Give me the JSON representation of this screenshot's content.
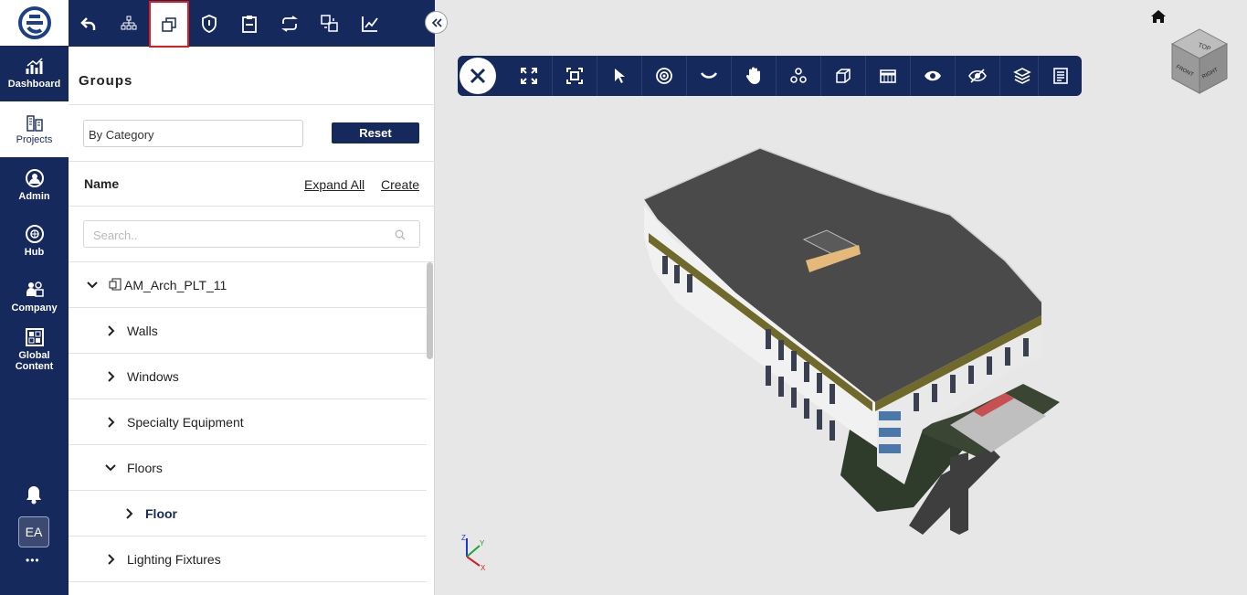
{
  "nav": {
    "items": [
      {
        "label": "Dashboard",
        "icon": "dashboard-chart-icon"
      },
      {
        "label": "Projects",
        "icon": "buildings-icon"
      },
      {
        "label": "Admin",
        "icon": "admin-user-icon"
      },
      {
        "label": "Hub",
        "icon": "hub-globe-icon"
      },
      {
        "label": "Company",
        "icon": "company-people-icon"
      },
      {
        "label": "Global Content",
        "icon": "global-content-icon"
      }
    ],
    "avatar": "EA",
    "more": "•••"
  },
  "panel": {
    "title": "Groups",
    "filter_value": "By Category",
    "reset_label": "Reset",
    "name_header": "Name",
    "expand_all": "Expand All",
    "create": "Create",
    "search_placeholder": "Search..",
    "tree": [
      {
        "label": "AM_Arch_PLT_11",
        "level": 0,
        "expanded": true
      },
      {
        "label": "Walls",
        "level": 1,
        "expanded": false
      },
      {
        "label": "Windows",
        "level": 1,
        "expanded": false
      },
      {
        "label": "Specialty Equipment",
        "level": 1,
        "expanded": false
      },
      {
        "label": "Floors",
        "level": 1,
        "expanded": true
      },
      {
        "label": "Floor",
        "level": 2,
        "expanded": false
      },
      {
        "label": "Lighting Fixtures",
        "level": 1,
        "expanded": false
      }
    ]
  },
  "toolbar": {
    "buttons": [
      "back-arrow-icon",
      "hierarchy-icon",
      "groups-icon",
      "shield-icon",
      "clipboard-rfi-icon",
      "sync-icon",
      "compare-icon",
      "markup-chart-icon"
    ],
    "selected": "groups-icon"
  },
  "viewer": {
    "tools": [
      "close-icon",
      "fullscreen-icon",
      "fit-view-icon",
      "select-pointer-icon",
      "orbit-target-icon",
      "look-icon",
      "pan-hand-icon",
      "explode-icon",
      "section-box-icon",
      "section-plane-icon",
      "show-icon",
      "hide-icon",
      "isolate-layers-icon",
      "properties-doc-icon"
    ],
    "viewcube": {
      "top": "TOP",
      "front": "FRONT",
      "right": "RIGHT"
    },
    "axes": {
      "x": "X",
      "y": "Y",
      "z": "Z"
    }
  },
  "colors": {
    "navy": "#16295c",
    "selected_border": "#e01b1b",
    "viewer_bg": "#e7e7e7"
  }
}
